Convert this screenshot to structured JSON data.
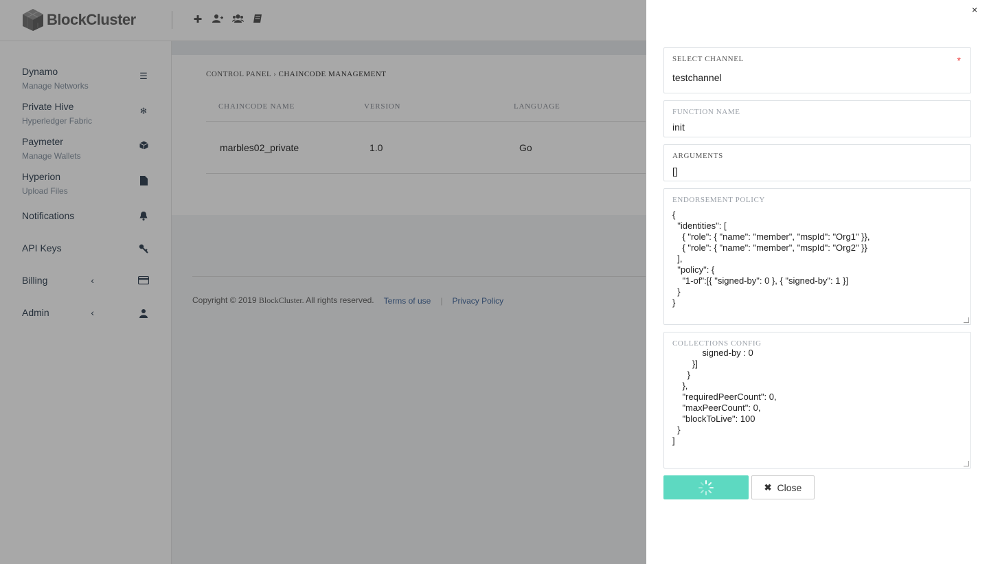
{
  "app": {
    "brand": "BlockCluster"
  },
  "topbar": {
    "icons": [
      "plus-icon",
      "add-user-icon",
      "users-icon",
      "book-icon"
    ]
  },
  "sidebar": {
    "items": [
      {
        "label": "Dynamo",
        "sub": "Manage Networks",
        "icon": "list-icon"
      },
      {
        "label": "Private Hive",
        "sub": "Hyperledger Fabric",
        "icon": "snowflake-icon"
      },
      {
        "label": "Paymeter",
        "sub": "Manage Wallets",
        "icon": "cube-icon"
      },
      {
        "label": "Hyperion",
        "sub": "Upload Files",
        "icon": "file-icon"
      },
      {
        "label": "Notifications",
        "icon": "bell-icon"
      },
      {
        "label": "API Keys",
        "icon": "key-icon"
      },
      {
        "label": "Billing",
        "icon": "credit-card-icon"
      },
      {
        "label": "Admin",
        "icon": "user-secret-icon"
      }
    ]
  },
  "breadcrumb": {
    "root": "CONTROL PANEL",
    "separator": "›",
    "current": "CHAINCODE MANAGEMENT"
  },
  "table": {
    "headers": [
      "CHAINCODE NAME",
      "VERSION",
      "LANGUAGE"
    ],
    "rows": [
      {
        "name": "marbles02_private",
        "version": "1.0",
        "language": "Go"
      }
    ]
  },
  "footer": {
    "copyright": "Copyright © 2019",
    "brand": "BlockCluster.",
    "rights": "All rights reserved.",
    "terms": "Terms of use",
    "privacy": "Privacy Policy"
  },
  "drawer": {
    "close_icon": "×",
    "channel": {
      "label": "SELECT CHANNEL",
      "value": "testchannel",
      "required": "*"
    },
    "function": {
      "label": "FUNCTION NAME",
      "value": "init"
    },
    "arguments": {
      "label": "ARGUMENTS",
      "value": "[]"
    },
    "endorsement": {
      "label": "ENDORSEMENT POLICY",
      "value": "{\n  \"identities\": [\n    { \"role\": { \"name\": \"member\", \"mspId\": \"Org1\" }},\n    { \"role\": { \"name\": \"member\", \"mspId\": \"Org2\" }}\n  ],\n  \"policy\": {\n    \"1-of\":[{ \"signed-by\": 0 }, { \"signed-by\": 1 }]\n  }\n}"
    },
    "collections": {
      "label": "COLLECTIONS CONFIG",
      "value": "            signed-by : 0\n        }]\n      }\n    },\n    \"requiredPeerCount\": 0,\n    \"maxPeerCount\": 0,\n    \"blockToLive\": 100\n  }\n]"
    },
    "close_button": "Close"
  }
}
